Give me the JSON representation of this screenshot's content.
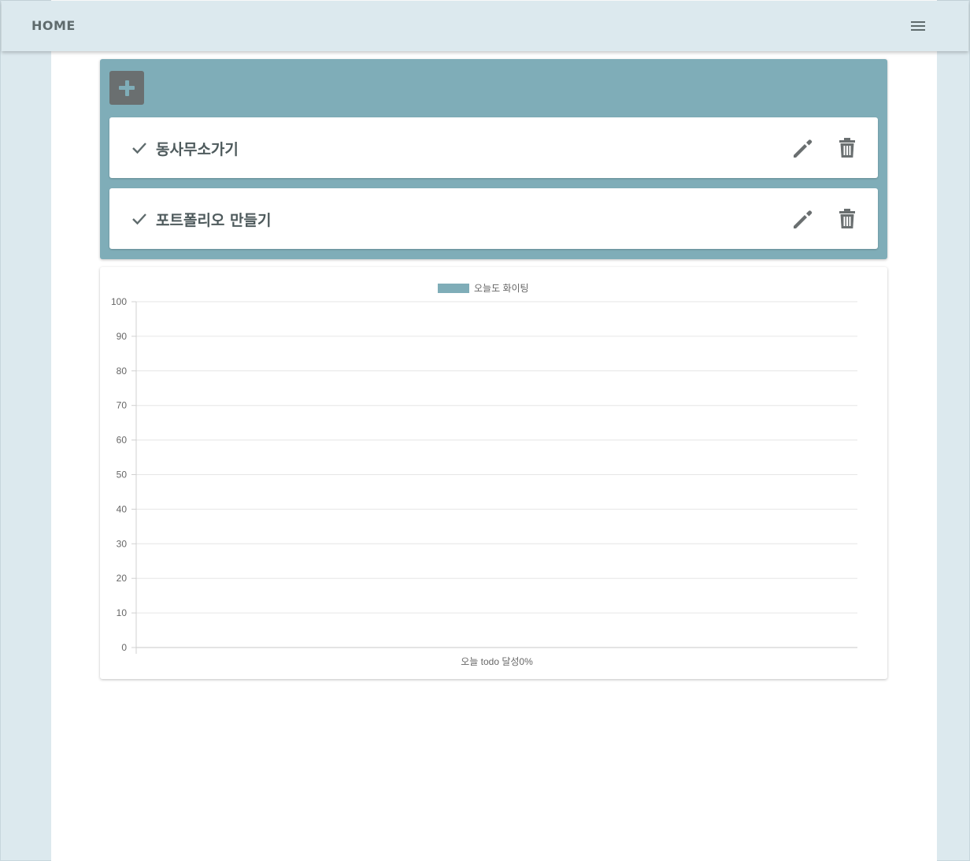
{
  "appbar": {
    "title": "HOME",
    "menu_icon": "menu-icon"
  },
  "todos": {
    "add_icon": "plus-icon",
    "items": [
      {
        "text": "동사무소가기",
        "icons": [
          "check-icon",
          "pencil-icon",
          "trash-icon"
        ]
      },
      {
        "text": "포트폴리오 만들기",
        "icons": [
          "check-icon",
          "pencil-icon",
          "trash-icon"
        ]
      }
    ]
  },
  "colors": {
    "accent": "#7fadb8",
    "background": "#dce9ee",
    "icon": "#6a6f70",
    "text": "#4e5a5c"
  },
  "chart_data": {
    "type": "bar",
    "categories": [
      "오늘 todo 달성0%"
    ],
    "series": [
      {
        "name": "오늘도 화이팅",
        "values": [
          0
        ],
        "color": "#7fadb8"
      }
    ],
    "ylim": [
      0,
      100
    ],
    "yticks": [
      "0",
      "10",
      "20",
      "30",
      "40",
      "50",
      "60",
      "70",
      "80",
      "90",
      "100"
    ],
    "grid": true,
    "legend": "top-center"
  }
}
